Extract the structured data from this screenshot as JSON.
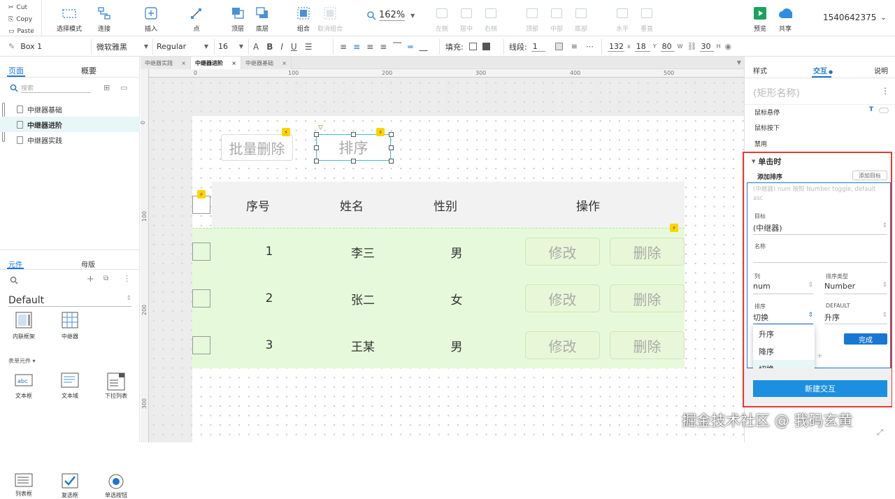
{
  "clipboard": {
    "cut": "Cut",
    "copy": "Copy",
    "paste": "Paste"
  },
  "toolbar": {
    "select_mode": "选择模式",
    "connect": "连接",
    "insert": "插入",
    "point": "点",
    "top_layer": "顶层",
    "bottom_layer": "底层",
    "group": "组合",
    "ungroup": "取消组合",
    "zoom": "162%",
    "align_left": "左侧",
    "align_center": "居中",
    "align_right": "右侧",
    "align_top": "顶部",
    "align_middle": "中部",
    "align_bottom": "底部",
    "distribute_h": "水平",
    "distribute_v": "垂直",
    "preview": "预览",
    "share": "共享",
    "account": "1540642375"
  },
  "format": {
    "element_name": "Box 1",
    "font_family": "微软雅黑",
    "font_weight": "Regular",
    "font_size": "16",
    "fill_label": "填充:",
    "line_label": "线段:",
    "line_width": "1",
    "x": "132",
    "y": "18",
    "w": "80",
    "h": "30",
    "x_label": "x",
    "y_label": "Y",
    "w_label": "W",
    "h_label": "H"
  },
  "left": {
    "tabs": [
      "页面",
      "概要"
    ],
    "search_placeholder": "搜索",
    "pages": [
      "中继器基础",
      "中继器进阶",
      "中继器实践"
    ],
    "lib_tabs": [
      "元件",
      "母版"
    ],
    "library": "Default",
    "widgets1": [
      "内联框架",
      "中继器"
    ],
    "form_section": "表单元件 ▾",
    "widgets2": [
      "文本框",
      "文本域",
      "下拉列表"
    ],
    "widgets3": [
      "列表框",
      "复选框",
      "单选按钮"
    ]
  },
  "canvas": {
    "doc_tabs": [
      "中继器实践",
      "中继器进阶",
      "中继器基础"
    ],
    "ruler_h": [
      "0",
      "100",
      "200",
      "300",
      "400",
      "500"
    ],
    "ruler_v": [
      "0",
      "100",
      "200",
      "300"
    ],
    "batch_delete": "批量删除",
    "sort": "排序",
    "headers": [
      "序号",
      "姓名",
      "性别",
      "操作"
    ],
    "rows": [
      {
        "no": "1",
        "name": "李三",
        "gender": "男"
      },
      {
        "no": "2",
        "name": "张二",
        "gender": "女"
      },
      {
        "no": "3",
        "name": "王某",
        "gender": "男"
      }
    ],
    "edit": "修改",
    "delete": "删除"
  },
  "right": {
    "tabs": [
      "样式",
      "交互",
      "说明"
    ],
    "shape_name": "(矩形名称)",
    "events": [
      "鼠标悬停",
      "鼠标按下",
      "禁用"
    ],
    "on_click": "单击时",
    "add_sort": "添加排序",
    "add_target": "添加目标",
    "summary": "(中继器) num 按照 Number toggle, default asc",
    "target_label": "目标",
    "target_value": "(中继器)",
    "name_label": "名称",
    "col_label": "列",
    "col_value": "num",
    "sort_type_label": "排序类型",
    "sort_type_value": "Number",
    "order_label": "排序",
    "order_value": "切换",
    "default_label": "DEFAULT",
    "default_value": "升序",
    "done": "完成",
    "options": [
      "升序",
      "降序",
      "切换"
    ],
    "new_interaction": "新建交互"
  },
  "watermark": "掘金技术社区 @ 我码玄黄",
  "colors": {
    "accent": "#1976d2",
    "highlight_red": "#e53935",
    "row_green": "#e6fadb",
    "selection_cyan": "#3fbfcc"
  }
}
